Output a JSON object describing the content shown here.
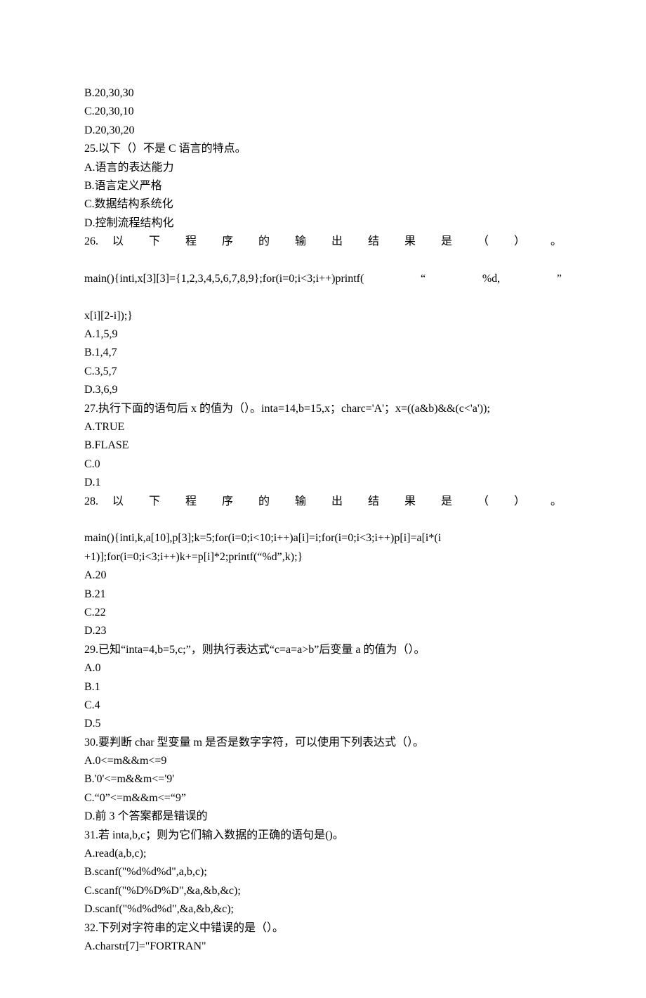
{
  "lines": [
    {
      "text": "B.20,30,30"
    },
    {
      "text": "C.20,30,10"
    },
    {
      "text": "D.20,30,20"
    },
    {
      "text": "25.以下（）不是 C 语言的特点。"
    },
    {
      "text": "A.语言的表达能力"
    },
    {
      "text": "B.语言定义严格"
    },
    {
      "text": "C.数据结构系统化"
    },
    {
      "text": "D.控制流程结构化"
    },
    {
      "text": "26. 以 下 程 序 的 输 出 结 果 是 （ ） 。",
      "class": "justified"
    },
    {
      "text": "main(){inti,x[3][3]={1,2,3,4,5,6,7,8,9};for(i=0;i<3;i++)printf(  “  %d,  ”",
      "class": "justified"
    },
    {
      "text": "x[i][2-i]);}"
    },
    {
      "text": "A.1,5,9"
    },
    {
      "text": "B.1,4,7"
    },
    {
      "text": "C.3,5,7"
    },
    {
      "text": "D.3,6,9"
    },
    {
      "text": "27.执行下面的语句后 x 的值为（）。inta=14,b=15,x；charc='A'；x=((a&b)&&(c<'a'));"
    },
    {
      "text": "A.TRUE"
    },
    {
      "text": "B.FLASE"
    },
    {
      "text": "C.0"
    },
    {
      "text": "D.1"
    },
    {
      "text": "28. 以 下 程 序 的 输 出 结 果 是 （ ） 。",
      "class": "justified"
    },
    {
      "text": "main(){inti,k,a[10],p[3];k=5;for(i=0;i<10;i++)a[i]=i;for(i=0;i<3;i++)p[i]=a[i*(i"
    },
    {
      "text": "+1)];for(i=0;i<3;i++)k+=p[i]*2;printf(“%d”,k);}"
    },
    {
      "text": "A.20"
    },
    {
      "text": "B.21"
    },
    {
      "text": "C.22"
    },
    {
      "text": "D.23"
    },
    {
      "text": "29.已知“inta=4,b=5,c;”，则执行表达式“c=a=a>b”后变量 a 的值为（）。"
    },
    {
      "text": "A.0"
    },
    {
      "text": "B.1"
    },
    {
      "text": "C.4"
    },
    {
      "text": "D.5"
    },
    {
      "text": "30.要判断 char 型变量 m 是否是数字字符，可以使用下列表达式（）。"
    },
    {
      "text": "A.0<=m&&m<=9"
    },
    {
      "text": "B.'0'<=m&&m<='9'"
    },
    {
      "text": "C.“0”<=m&&m<=“9”"
    },
    {
      "text": "D.前 3 个答案都是错误的"
    },
    {
      "text": "31.若 inta,b,c；则为它们输入数据的正确的语句是()。"
    },
    {
      "text": "A.read(a,b,c);"
    },
    {
      "text": "B.scanf(\"%d%d%d\",a,b,c);"
    },
    {
      "text": "C.scanf(\"%D%D%D\",&a,&b,&c);"
    },
    {
      "text": "D.scanf(\"%d%d%d\",&a,&b,&c);"
    },
    {
      "text": "32.下列对字符串的定义中错误的是（）。"
    },
    {
      "text": "A.charstr[7]=\"FORTRAN\""
    }
  ]
}
